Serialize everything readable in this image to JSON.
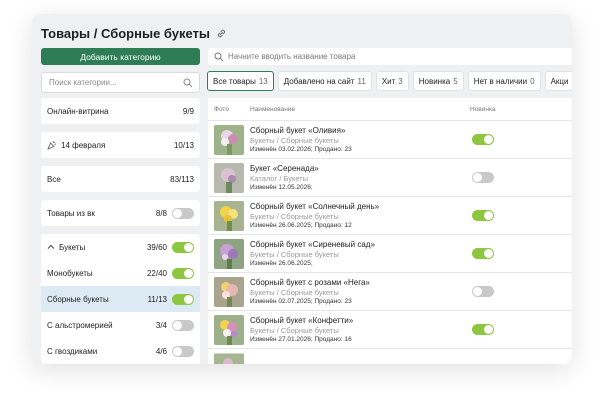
{
  "header": {
    "title": "Товары / Сборные букеты"
  },
  "toolbar": {
    "add_category": "Добавить категорию",
    "search_placeholder": "Начните вводить название товара"
  },
  "sidebar": {
    "search_placeholder": "Поиск категории...",
    "items": [
      {
        "label": "Онлайн-витрина",
        "count": "9/9"
      },
      {
        "label": "14 февраля",
        "count": "10/13"
      },
      {
        "label": "Все",
        "count": "83/113"
      },
      {
        "label": "Товары из вк",
        "count": "8/8"
      },
      {
        "label": "Букеты",
        "count": "39/60"
      },
      {
        "label": "Монобукеты",
        "count": "22/40"
      },
      {
        "label": "Сборные букеты",
        "count": "11/13"
      },
      {
        "label": "С альстромерией",
        "count": "3/4"
      },
      {
        "label": "С гвоздиками",
        "count": "4/6"
      }
    ]
  },
  "filters": [
    {
      "label": "Все товары",
      "count": "13"
    },
    {
      "label": "Добавлено на сайт",
      "count": "11"
    },
    {
      "label": "Хит",
      "count": "3"
    },
    {
      "label": "Новинка",
      "count": "5"
    },
    {
      "label": "Нет в наличии",
      "count": "0"
    },
    {
      "label": "Акци",
      "count": ""
    }
  ],
  "table": {
    "headers": {
      "photo": "Фото",
      "name": "Наименование",
      "new": "Новинка"
    },
    "rows": [
      {
        "name": "Сборный букет «Оливия»",
        "category": "Букеты / Сборные букеты",
        "meta": "Изменён 03.02.2026; Продано: 23"
      },
      {
        "name": "Букет «Серенада»",
        "category": "Каталог / Букеты",
        "meta": "Изменён 12.05.2026;"
      },
      {
        "name": "Сборный букет «Солнечный день»",
        "category": "Букеты / Сборные букеты",
        "meta": "Изменён 26.06.2025; Продано: 12"
      },
      {
        "name": "Сборный букет «Сиреневый сад»",
        "category": "Букеты / Сборные букеты",
        "meta": "Изменён 26.06.2025;"
      },
      {
        "name": "Сборный букет с розами «Нега»",
        "category": "Букеты / Сборные букеты",
        "meta": "Изменён 02.07.2025; Продано: 23"
      },
      {
        "name": "Сборный букет «Конфетти»",
        "category": "Букеты / Сборные букеты",
        "meta": "Изменён 27.01.2026; Продано: 16"
      }
    ]
  },
  "colors": {
    "accent": "#2e7d55",
    "toggle_on": "#8dc63f",
    "toggle_off": "#c9c9c9",
    "selected_row": "#dbeaf3"
  }
}
